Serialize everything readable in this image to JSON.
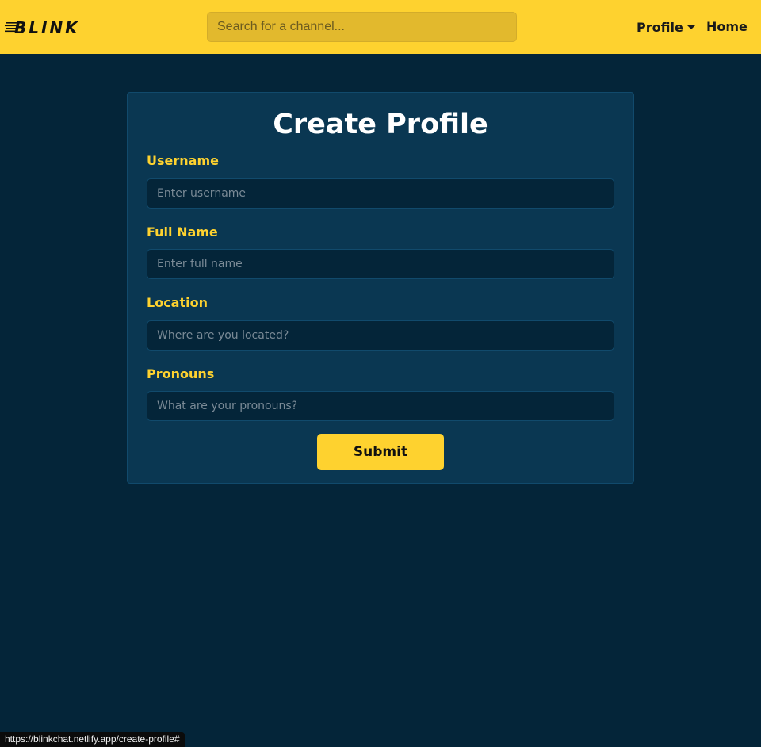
{
  "navbar": {
    "logo_text": "BLINK",
    "search_placeholder": "Search for a channel...",
    "profile_label": "Profile",
    "home_label": "Home"
  },
  "form": {
    "title": "Create Profile",
    "fields": [
      {
        "label": "Username",
        "placeholder": "Enter username",
        "value": ""
      },
      {
        "label": "Full Name",
        "placeholder": "Enter full name",
        "value": ""
      },
      {
        "label": "Location",
        "placeholder": "Where are you located?",
        "value": ""
      },
      {
        "label": "Pronouns",
        "placeholder": "What are your pronouns?",
        "value": ""
      }
    ],
    "submit_label": "Submit"
  },
  "status_bar": {
    "url": "https://blinkchat.netlify.app/create-profile#"
  },
  "colors": {
    "navbar_bg": "#fed22f",
    "page_bg": "#042539",
    "card_bg": "#0a3752",
    "label": "#fed22f",
    "title": "#ffffff"
  },
  "icons": {
    "logo": "blink-logo",
    "profile_caret": "caret-down-icon"
  }
}
